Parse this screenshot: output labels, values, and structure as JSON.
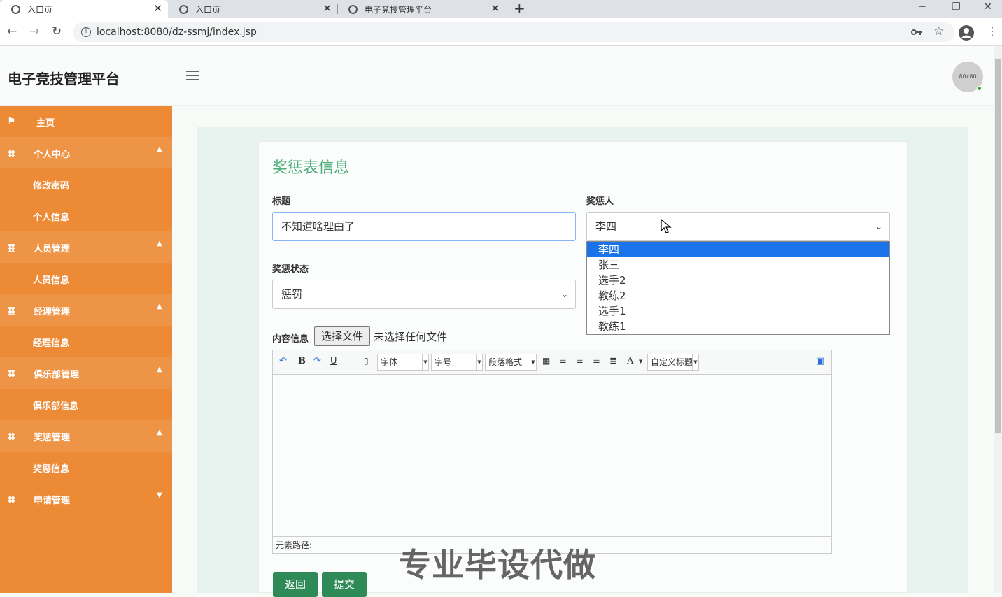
{
  "browser": {
    "tabs": [
      {
        "title": "入口页",
        "active": true
      },
      {
        "title": "入口页",
        "active": false
      },
      {
        "title": "电子竞技管理平台",
        "active": false
      }
    ],
    "new_tab": "+",
    "url": "localhost:8080/dz-ssmj/index.jsp",
    "window_controls": {
      "minimize": "─",
      "restore": "❐",
      "close": "✕"
    },
    "nav": {
      "back": "←",
      "forward": "→",
      "reload": "↻"
    },
    "icons": {
      "key": "key-icon",
      "star": "star-icon",
      "profile": "profile-icon",
      "menu": "more-icon"
    }
  },
  "header": {
    "brand": "电子竞技管理平台",
    "avatar_text": "80x80"
  },
  "sidebar": {
    "items": [
      {
        "label": "主页",
        "icon": "flag-icon",
        "type": "top"
      },
      {
        "label": "个人中心",
        "icon": "grid-icon",
        "type": "group",
        "caret": "▲"
      },
      {
        "label": "修改密码",
        "type": "sub"
      },
      {
        "label": "个人信息",
        "type": "sub"
      },
      {
        "label": "人员管理",
        "icon": "grid-icon",
        "type": "group",
        "caret": "▲"
      },
      {
        "label": "人员信息",
        "type": "sub"
      },
      {
        "label": "经理管理",
        "icon": "grid-icon",
        "type": "group",
        "caret": "▲"
      },
      {
        "label": "经理信息",
        "type": "sub"
      },
      {
        "label": "俱乐部管理",
        "icon": "grid-icon",
        "type": "group",
        "caret": "▲"
      },
      {
        "label": "俱乐部信息",
        "type": "sub"
      },
      {
        "label": "奖惩管理",
        "icon": "grid-icon",
        "type": "group",
        "caret": "▲"
      },
      {
        "label": "奖惩信息",
        "type": "sub"
      },
      {
        "label": "申请管理",
        "icon": "grid-icon",
        "type": "group",
        "caret": "▼"
      }
    ]
  },
  "form": {
    "title": "奖惩表信息",
    "title_label": "标题",
    "title_value": "不知道啥理由了",
    "person_label": "奖惩人",
    "person_value": "李四",
    "person_options": [
      "李四",
      "张三",
      "选手2",
      "教练2",
      "选手1",
      "教练1"
    ],
    "status_label": "奖惩状态",
    "status_value": "惩罚",
    "content_label": "内容信息",
    "file_button": "选择文件",
    "file_status": "未选择任何文件",
    "editor": {
      "font_select": "字体",
      "size_select": "字号",
      "paragraph_select": "段落格式",
      "custom_title_select": "自定义标题",
      "bold": "B",
      "underline": "U",
      "font_color": "A",
      "element_path": "元素路径:"
    },
    "back_button": "返回",
    "submit_button": "提交"
  },
  "watermark": "专业毕设代做",
  "colors": {
    "sidebar": "#ec8a36",
    "accent": "#4dae7b",
    "button": "#2e8b57",
    "selected_option": "#1a73e8"
  }
}
